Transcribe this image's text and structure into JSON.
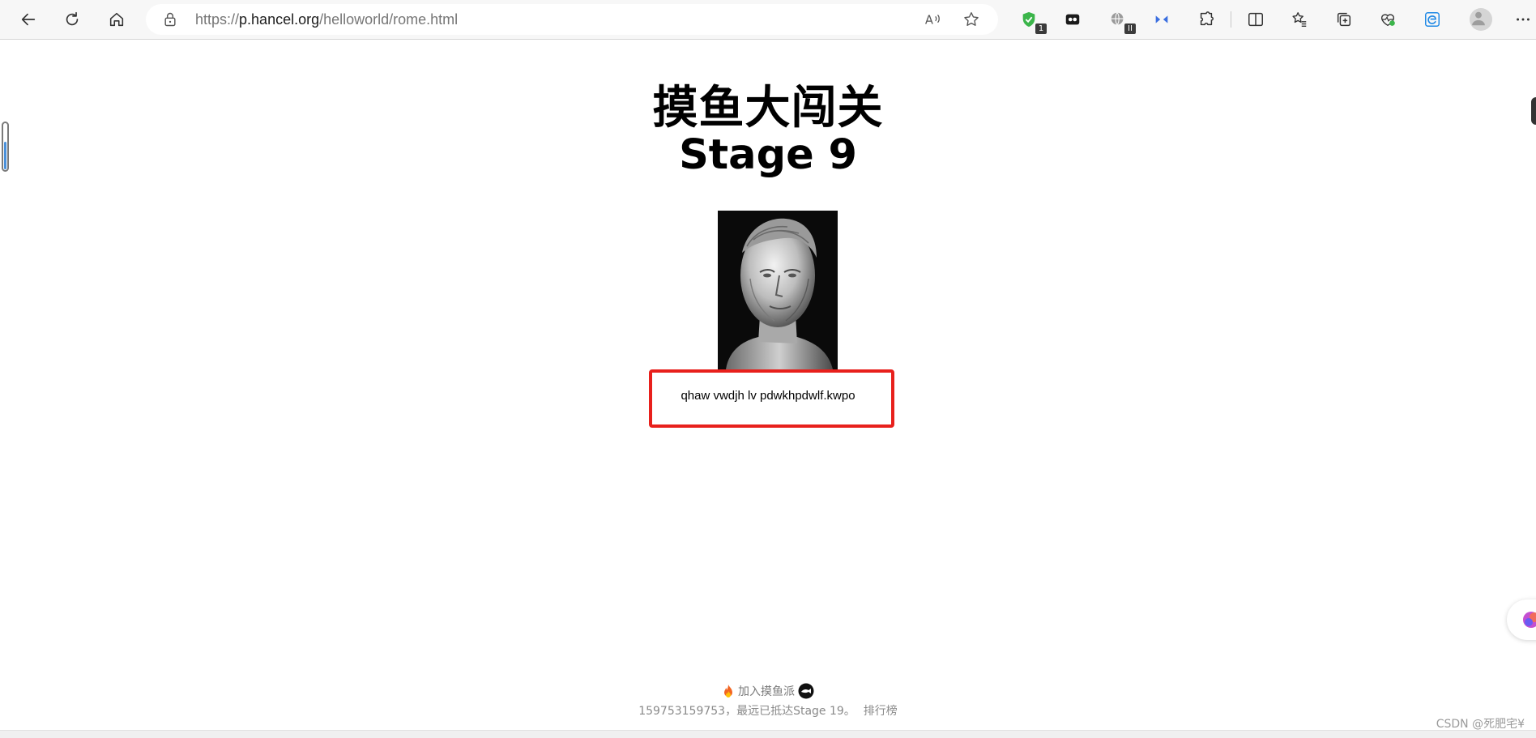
{
  "browser": {
    "url_prefix": "https://",
    "url_host": "p.hancel.org",
    "url_path": "/helloworld/rome.html",
    "extension_badge_1": "1",
    "extension_badge_2": "II"
  },
  "page": {
    "title_cn": "摸鱼大闯关",
    "title_stage": "Stage 9",
    "answer_text": "qhaw vwdjh lv pdwkhpdwlf.kwpo"
  },
  "footer": {
    "join_label": "加入摸鱼派",
    "status_text": "159753159753，最远已抵达Stage 19。",
    "leaderboard_label": "排行榜"
  },
  "watermark": "CSDN @死肥宅¥",
  "colors": {
    "highlight_border": "#e8201c",
    "toolbar_bg": "#f7f7f7"
  },
  "icons": [
    "back-icon",
    "refresh-icon",
    "home-icon",
    "lock-icon",
    "read-aloud-icon",
    "favorite-star-icon",
    "shield-extension-icon",
    "tab-extension-icon",
    "globe-extension-icon",
    "arrows-extension-icon",
    "puzzle-icon",
    "split-screen-icon",
    "favorites-list-icon",
    "collections-icon",
    "health-icon",
    "edge-icon",
    "profile-avatar-icon",
    "more-menu-icon",
    "flame-icon",
    "fish-icon"
  ]
}
